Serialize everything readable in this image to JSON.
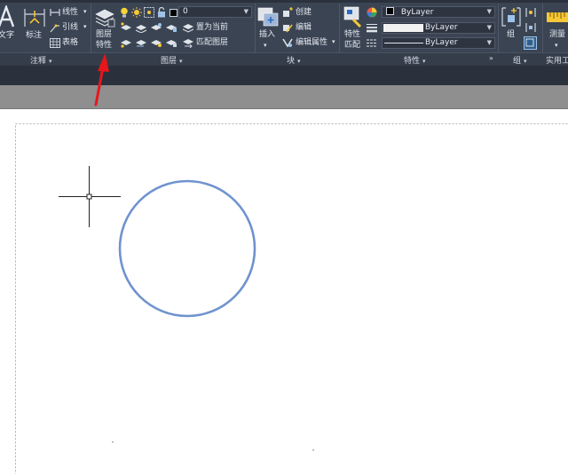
{
  "annotate": {
    "text_label": "文字",
    "dimension_label": "标注",
    "linear_label": "线性",
    "leader_label": "引线",
    "table_label": "表格",
    "panel_title": "注释"
  },
  "layers": {
    "properties_label_1": "图层",
    "properties_label_2": "特性",
    "current_layer": "0",
    "set_current_label": "置为当前",
    "match_layer_label": "匹配图层",
    "panel_title": "图层"
  },
  "block": {
    "insert_label": "插入",
    "create_label": "创建",
    "edit_label": "编辑",
    "edit_attributes_label": "编辑属性",
    "panel_title": "块"
  },
  "properties": {
    "match_label_1": "特性",
    "match_label_2": "匹配",
    "color_value": "ByLayer",
    "lineweight_value": "ByLayer",
    "linetype_value": "ByLayer",
    "panel_title": "特性"
  },
  "groups": {
    "group_label": "组",
    "panel_title": "组"
  },
  "utilities": {
    "measure_label": "测量",
    "panel_title": "实用工"
  },
  "colors": {
    "ribbon_bg": "#3b4453",
    "circle_stroke": "#6f93cf",
    "annotation_arrow": "#e8161b"
  }
}
